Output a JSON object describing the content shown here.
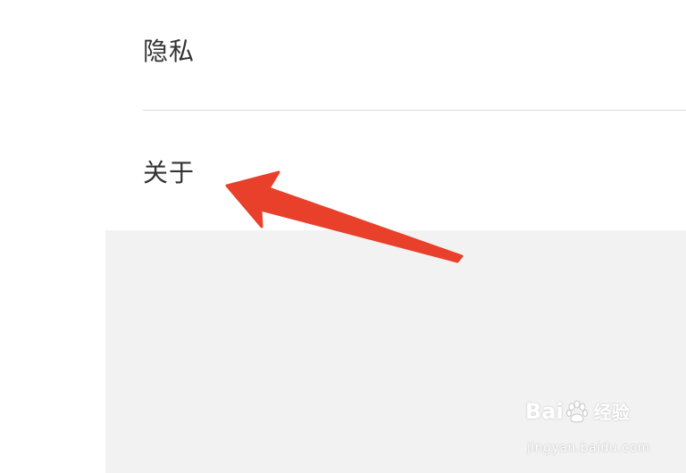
{
  "settings": {
    "items": [
      {
        "label": "隐私"
      },
      {
        "label": "关于"
      }
    ]
  },
  "annotation": {
    "color": "#e8402a",
    "icon": "arrow-icon"
  },
  "watermark": {
    "brand": "Baidu",
    "brand_cn": "经验",
    "url": "jingyan.baidu.com",
    "icon": "paw-icon"
  },
  "colors": {
    "background": "#ffffff",
    "empty_area": "#f2f2f2",
    "divider": "#dcdcdc",
    "text": "#333333"
  }
}
